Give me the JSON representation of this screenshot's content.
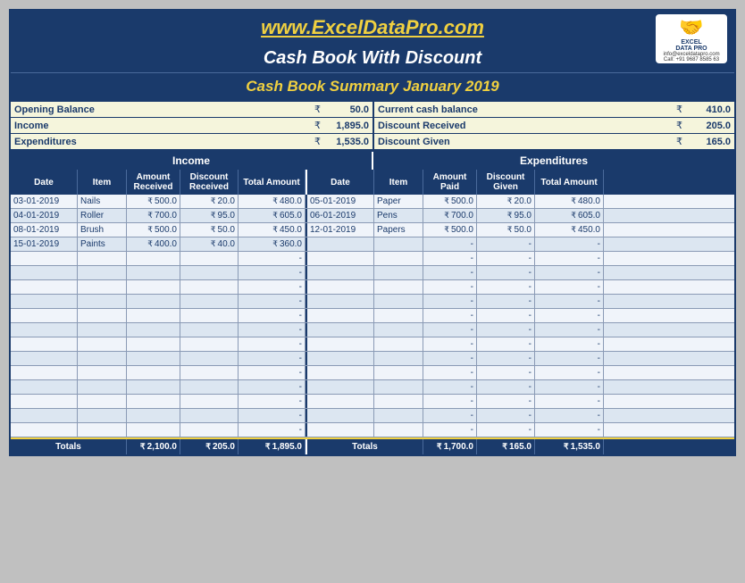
{
  "header": {
    "url": "www.ExcelDataPro.com",
    "title": "Cash Book With Discount",
    "subtitle": "Cash Book Summary January 2019",
    "logo_contact1": "info@exceldatapro.com",
    "logo_contact2": "Call: +91 9687 8585 63"
  },
  "summary": {
    "left": [
      {
        "label": "Opening Balance",
        "value": "50.0"
      },
      {
        "label": "Income",
        "value": "1,895.0"
      },
      {
        "label": "Expenditures",
        "value": "1,535.0"
      }
    ],
    "right": [
      {
        "label": "Current cash balance",
        "value": "410.0"
      },
      {
        "label": "Discount Received",
        "value": "205.0"
      },
      {
        "label": "Discount Given",
        "value": "165.0"
      }
    ]
  },
  "section_headers": {
    "income": "Income",
    "expenditure": "Expenditures"
  },
  "col_headers": {
    "date": "Date",
    "item": "Item",
    "amount_received": "Amount Received",
    "discount_received": "Discount Received",
    "total_amount_l": "Total Amount",
    "amount_paid": "Amount Paid",
    "discount_given": "Discount Given",
    "total_amount_r": "Total Amount"
  },
  "income_rows": [
    {
      "date": "03-01-2019",
      "item": "Nails",
      "amount": "500.0",
      "discount": "20.0",
      "total": "480.0"
    },
    {
      "date": "04-01-2019",
      "item": "Roller",
      "amount": "700.0",
      "discount": "95.0",
      "total": "605.0"
    },
    {
      "date": "08-01-2019",
      "item": "Brush",
      "amount": "500.0",
      "discount": "50.0",
      "total": "450.0"
    },
    {
      "date": "15-01-2019",
      "item": "Paints",
      "amount": "400.0",
      "discount": "40.0",
      "total": "360.0"
    },
    {
      "date": "",
      "item": "",
      "amount": "",
      "discount": "",
      "total": "-"
    },
    {
      "date": "",
      "item": "",
      "amount": "",
      "discount": "",
      "total": "-"
    },
    {
      "date": "",
      "item": "",
      "amount": "",
      "discount": "",
      "total": "-"
    },
    {
      "date": "",
      "item": "",
      "amount": "",
      "discount": "",
      "total": "-"
    },
    {
      "date": "",
      "item": "",
      "amount": "",
      "discount": "",
      "total": "-"
    },
    {
      "date": "",
      "item": "",
      "amount": "",
      "discount": "",
      "total": "-"
    },
    {
      "date": "",
      "item": "",
      "amount": "",
      "discount": "",
      "total": "-"
    },
    {
      "date": "",
      "item": "",
      "amount": "",
      "discount": "",
      "total": "-"
    },
    {
      "date": "",
      "item": "",
      "amount": "",
      "discount": "",
      "total": "-"
    },
    {
      "date": "",
      "item": "",
      "amount": "",
      "discount": "",
      "total": "-"
    },
    {
      "date": "",
      "item": "",
      "amount": "",
      "discount": "",
      "total": "-"
    },
    {
      "date": "",
      "item": "",
      "amount": "",
      "discount": "",
      "total": "-"
    },
    {
      "date": "",
      "item": "",
      "amount": "",
      "discount": "",
      "total": "-"
    }
  ],
  "expenditure_rows": [
    {
      "date": "05-01-2019",
      "item": "Paper",
      "amount": "500.0",
      "discount": "20.0",
      "total": "480.0"
    },
    {
      "date": "06-01-2019",
      "item": "Pens",
      "amount": "700.0",
      "discount": "95.0",
      "total": "605.0"
    },
    {
      "date": "12-01-2019",
      "item": "Papers",
      "amount": "500.0",
      "discount": "50.0",
      "total": "450.0"
    },
    {
      "date": "",
      "item": "",
      "amount": "-",
      "discount": "-",
      "total": "-"
    },
    {
      "date": "",
      "item": "",
      "amount": "-",
      "discount": "-",
      "total": "-"
    },
    {
      "date": "",
      "item": "",
      "amount": "-",
      "discount": "-",
      "total": "-"
    },
    {
      "date": "",
      "item": "",
      "amount": "-",
      "discount": "-",
      "total": "-"
    },
    {
      "date": "",
      "item": "",
      "amount": "-",
      "discount": "-",
      "total": "-"
    },
    {
      "date": "",
      "item": "",
      "amount": "-",
      "discount": "-",
      "total": "-"
    },
    {
      "date": "",
      "item": "",
      "amount": "-",
      "discount": "-",
      "total": "-"
    },
    {
      "date": "",
      "item": "",
      "amount": "-",
      "discount": "-",
      "total": "-"
    },
    {
      "date": "",
      "item": "",
      "amount": "-",
      "discount": "-",
      "total": "-"
    },
    {
      "date": "",
      "item": "",
      "amount": "-",
      "discount": "-",
      "total": "-"
    },
    {
      "date": "",
      "item": "",
      "amount": "-",
      "discount": "-",
      "total": "-"
    },
    {
      "date": "",
      "item": "",
      "amount": "-",
      "discount": "-",
      "total": "-"
    },
    {
      "date": "",
      "item": "",
      "amount": "-",
      "discount": "-",
      "total": "-"
    },
    {
      "date": "",
      "item": "",
      "amount": "-",
      "discount": "-",
      "total": "-"
    }
  ],
  "totals": {
    "label": "Totals",
    "income_amount": "2,100.0",
    "income_discount": "205.0",
    "income_total": "1,895.0",
    "exp_amount": "1,700.0",
    "exp_discount": "165.0",
    "exp_total": "1,535.0"
  }
}
